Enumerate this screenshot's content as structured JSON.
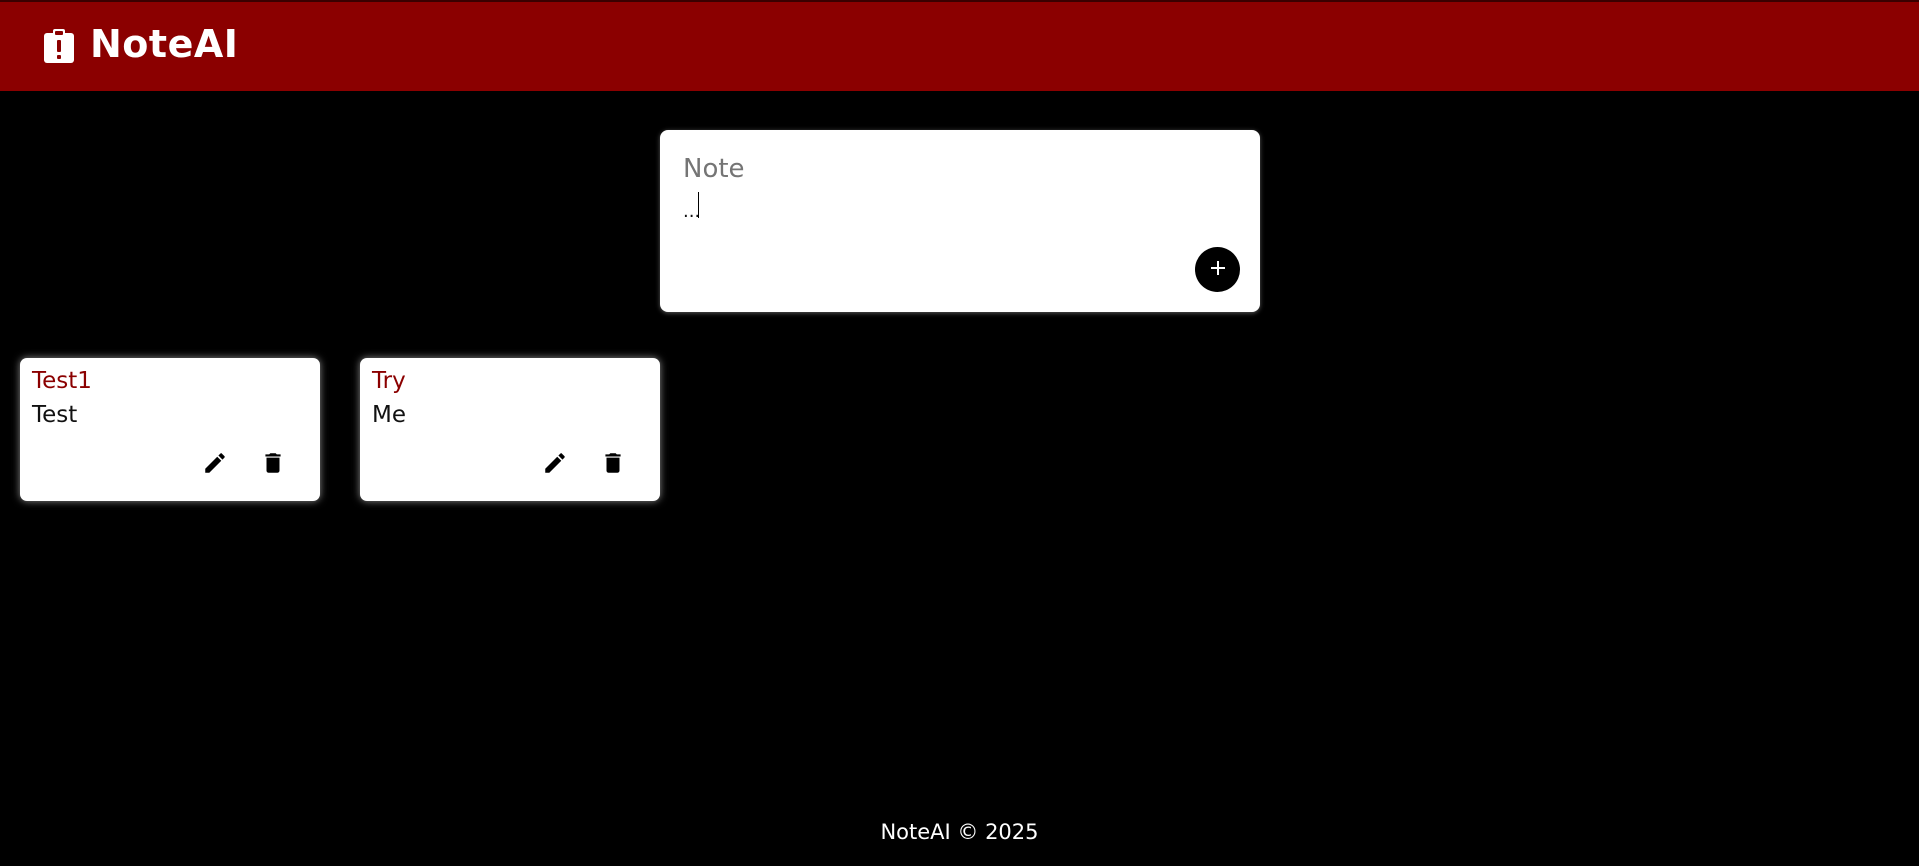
{
  "header": {
    "title": "NoteAI",
    "logo_icon": "clipboard-alert-icon"
  },
  "composer": {
    "title_placeholder": "Note",
    "content_value": "...",
    "add_icon": "plus-icon"
  },
  "notes": [
    {
      "title": "Test1",
      "content": "Test",
      "edit_icon": "pencil-icon",
      "delete_icon": "trash-icon"
    },
    {
      "title": "Try",
      "content": "Me",
      "edit_icon": "pencil-icon",
      "delete_icon": "trash-icon"
    }
  ],
  "footer": {
    "text": "NoteAI © 2025"
  },
  "colors": {
    "header_bg": "#8b0000",
    "note_title": "#8b0000",
    "background": "#000000"
  }
}
